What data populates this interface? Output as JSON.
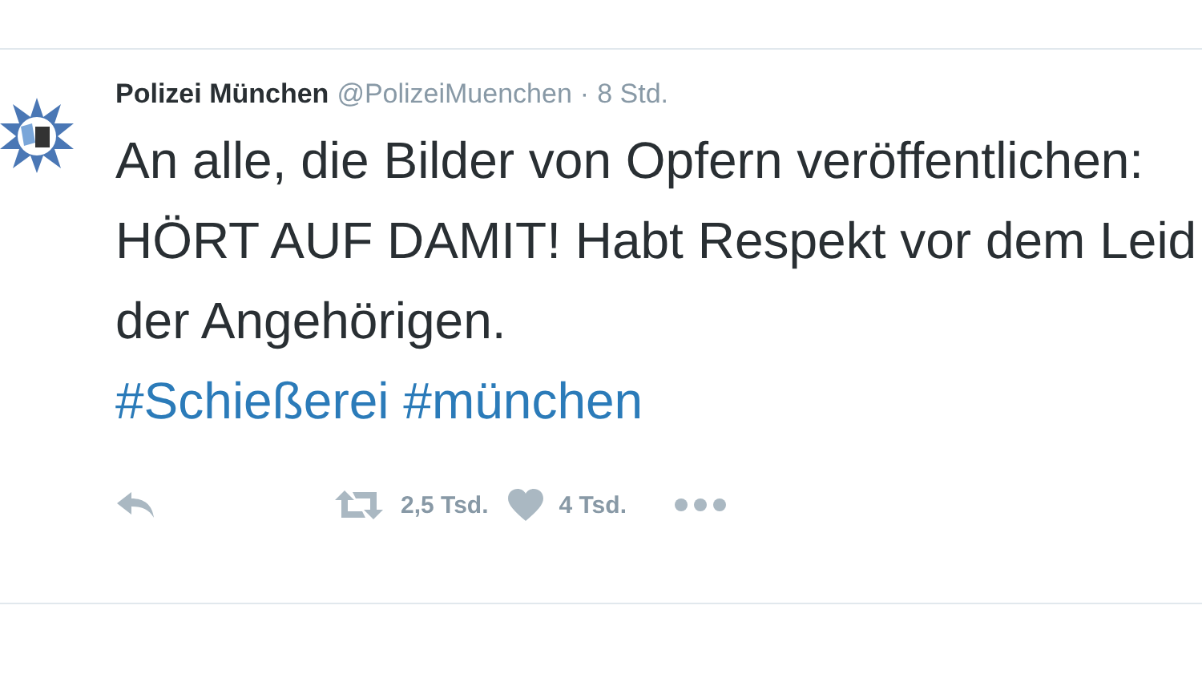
{
  "tweet": {
    "author": "Polizei München",
    "handle": "@PolizeiMuenchen",
    "time": "8 Std.",
    "separator": "·",
    "text": "An alle, die Bilder von Opfern veröffentlichen: HÖRT AUF DAMIT! Habt Respekt vor dem Leid der Angehörigen.",
    "hashtags": [
      "#Schießerei",
      "#münchen"
    ],
    "retweets": "2,5 Tsd.",
    "likes": "4 Tsd."
  }
}
